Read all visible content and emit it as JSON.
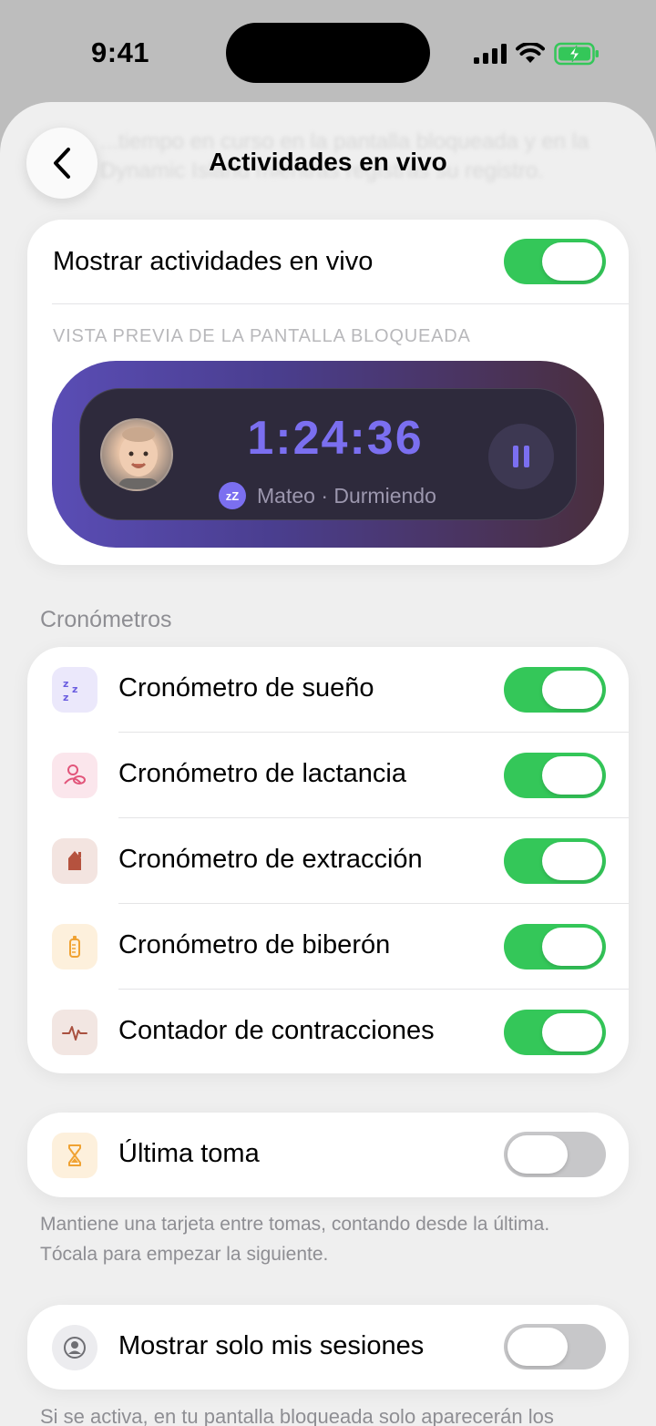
{
  "status_bar": {
    "time": "9:41"
  },
  "background": {
    "ghost_text": "...tiempo en curso en la pantalla bloqueada y en la Dynamic Island mientras registras su registro."
  },
  "nav": {
    "title": "Actividades en vivo"
  },
  "live_activities": {
    "label": "Mostrar actividades en vivo",
    "enabled": true,
    "preview_caption": "VISTA PREVIA DE LA PANTALLA BLOQUEADA",
    "preview": {
      "time": "1:24:36",
      "subtitle": "Mateo · Durmiendo",
      "badge": "zZ"
    }
  },
  "timers": {
    "header": "Cronómetros",
    "items": [
      {
        "label": "Cronómetro de sueño",
        "icon": "sleep-zz-icon",
        "enabled": true,
        "tile_color": "#ebe8fb"
      },
      {
        "label": "Cronómetro de lactancia",
        "icon": "breastfeeding-icon",
        "enabled": true,
        "tile_color": "#fbe6ec"
      },
      {
        "label": "Cronómetro de extracción",
        "icon": "pump-icon",
        "enabled": true,
        "tile_color": "#f3e4e0"
      },
      {
        "label": "Cronómetro de biberón",
        "icon": "bottle-icon",
        "enabled": true,
        "tile_color": "#fdf0dc"
      },
      {
        "label": "Contador de contracciones",
        "icon": "pulse-icon",
        "enabled": true,
        "tile_color": "#f2e6e2"
      }
    ]
  },
  "last_feed": {
    "label": "Última toma",
    "icon": "hourglass-icon",
    "enabled": false,
    "footnote": "Mantiene una tarjeta entre tomas, contando desde la última. Tócala para empezar la siguiente."
  },
  "my_sessions": {
    "label": "Mostrar solo mis sesiones",
    "icon": "person-icon",
    "enabled": false,
    "footnote": "Si se activa, en tu pantalla bloqueada solo aparecerán los"
  },
  "colors": {
    "toggle_on": "#34c759",
    "toggle_off": "#c7c7c9",
    "accent": "#7b6ff0"
  }
}
